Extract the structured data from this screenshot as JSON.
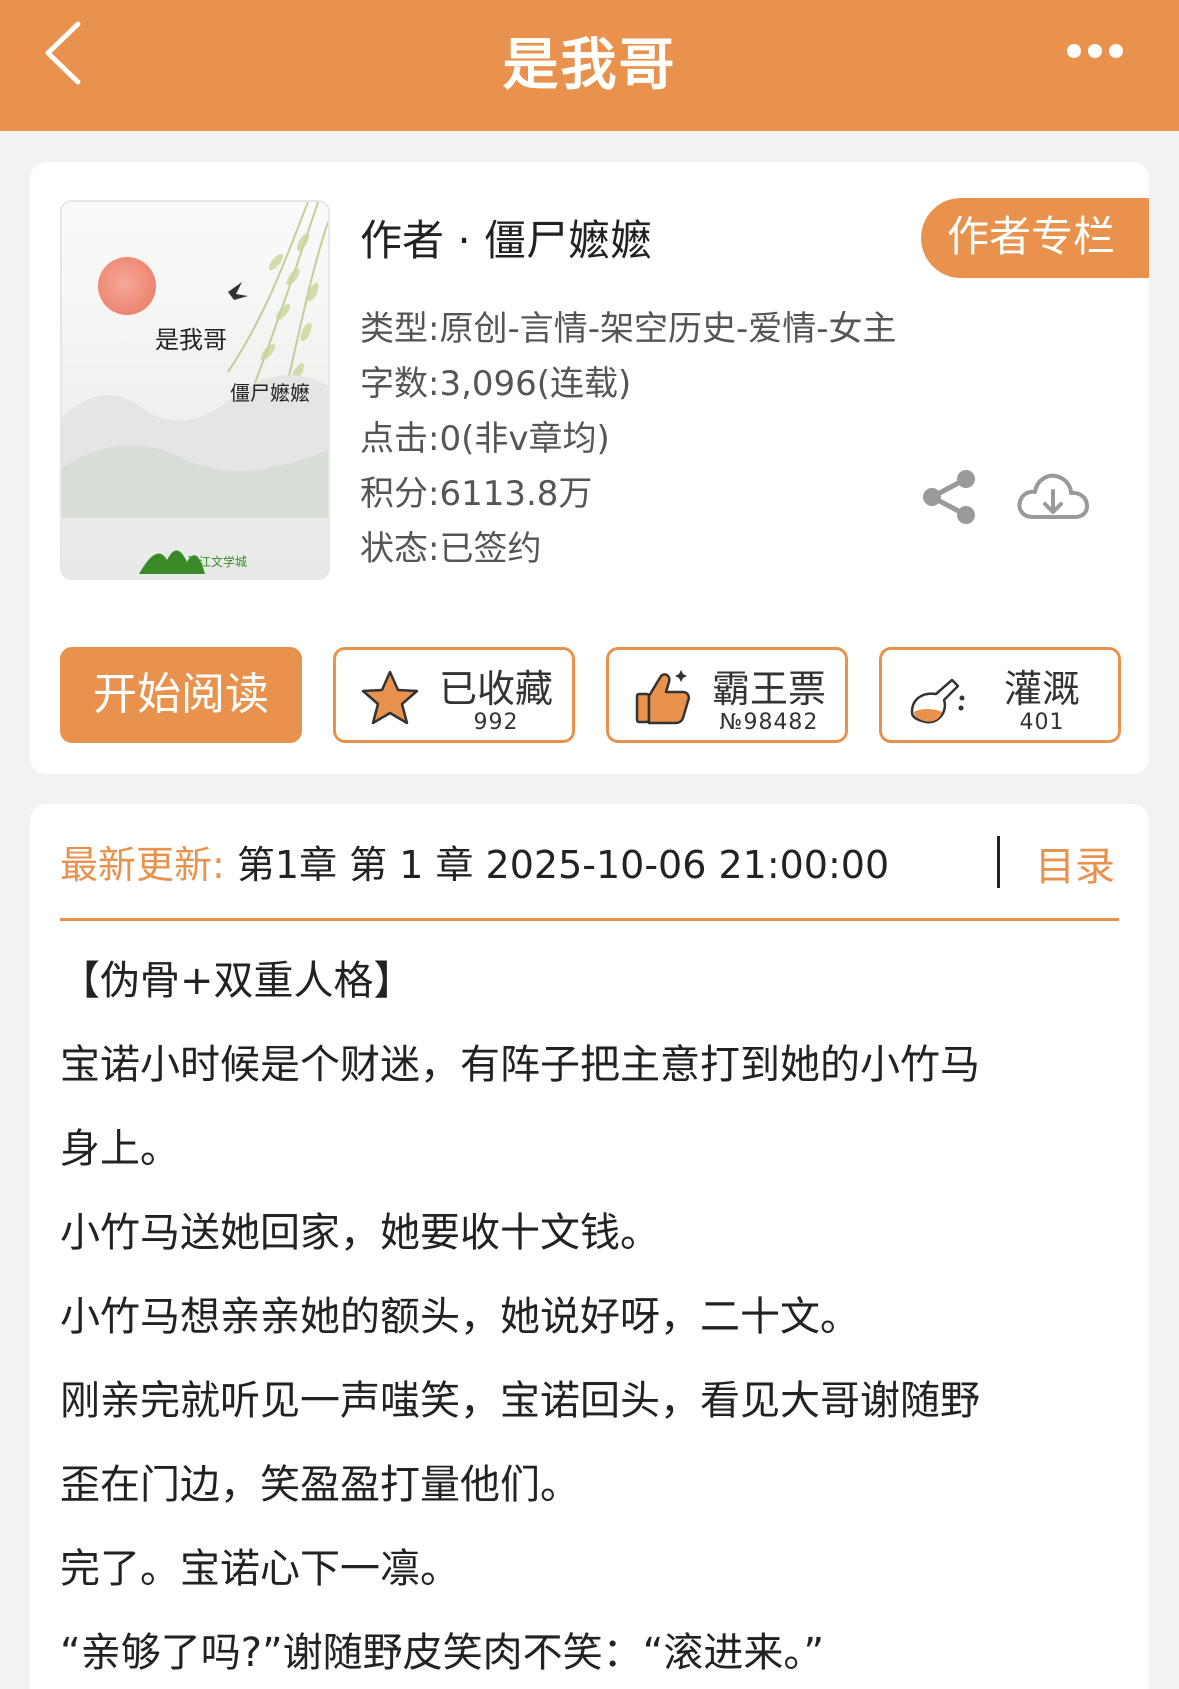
{
  "header": {
    "title": "是我哥",
    "back_icon": "chevron-left-icon",
    "more_icon": "more-dots-icon"
  },
  "book": {
    "cover": {
      "title": "是我哥",
      "author": "僵尸嬷嬷",
      "logo_text": "晋江文学城"
    },
    "author_line": "作者 · 僵尸嬷嬷",
    "author_column_button": "作者专栏",
    "meta": [
      "类型:原创-言情-架空历史-爱情-女主",
      "字数:3,096(连载)",
      "点击:0(非v章均)",
      "积分:6113.8万",
      "状态:已签约"
    ],
    "share_icon": "share-icon",
    "download_icon": "cloud-download-icon"
  },
  "actions": {
    "read": "开始阅读",
    "favorite": {
      "label": "已收藏",
      "count": "992",
      "icon": "star-icon"
    },
    "vote": {
      "label": "霸王票",
      "count": "№98482",
      "icon": "thumbs-up-icon"
    },
    "water": {
      "label": "灌溉",
      "count": "401",
      "icon": "watering-flask-icon"
    }
  },
  "latest": {
    "label": "最新更新:",
    "value": " 第1章 第 1 章 2025-10-06 21:00:00",
    "toc": "目录"
  },
  "description": [
    "【伪骨+双重人格】",
    "宝诺小时候是个财迷，有阵子把主意打到她的小竹马",
    "身上。",
    "小竹马送她回家，她要收十文钱。",
    "小竹马想亲亲她的额头，她说好呀，二十文。",
    "刚亲完就听见一声嗤笑，宝诺回头，看见大哥谢随野",
    "歪在门边，笑盈盈打量他们。",
    "完了。宝诺心下一凛。",
    "“亲够了吗?”谢随野皮笑肉不笑：“滚进来。”"
  ],
  "colors": {
    "accent": "#e9924d",
    "background": "#f2f2f2",
    "card": "#ffffff"
  }
}
